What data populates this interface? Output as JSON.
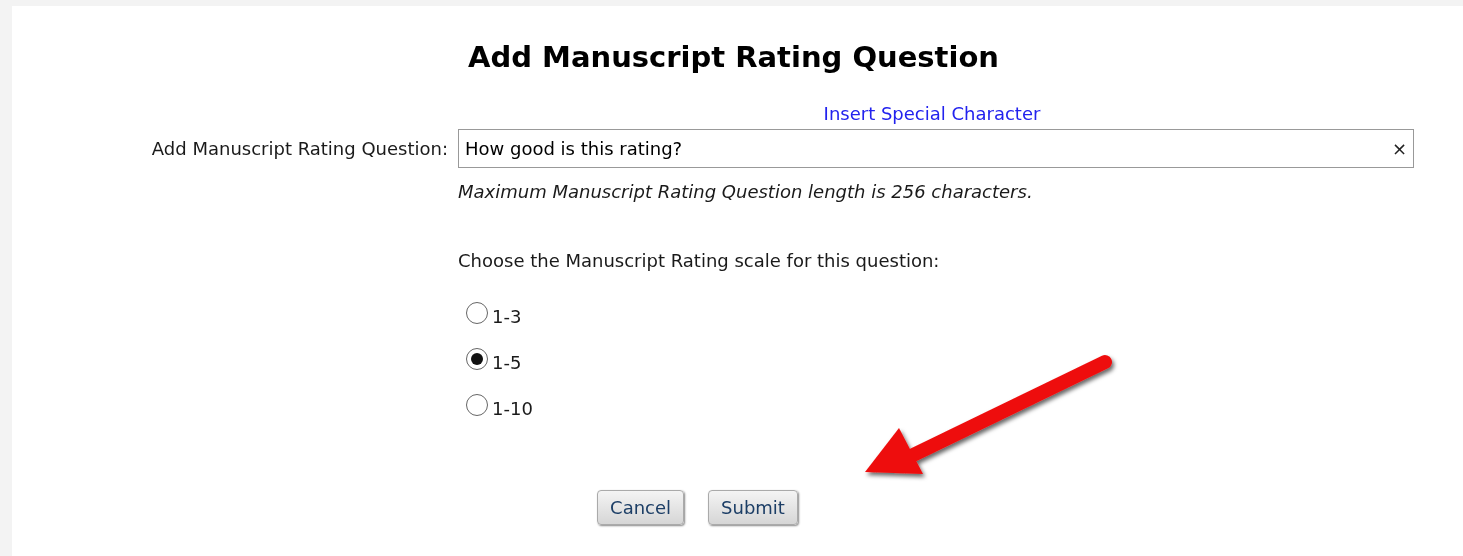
{
  "title": "Add Manuscript Rating Question",
  "special_char_link": "Insert Special Character",
  "question": {
    "label": "Add Manuscript Rating Question:",
    "value": "How good is this rating?",
    "clear": "×",
    "hint": "Maximum Manuscript Rating Question length is 256 characters."
  },
  "scale": {
    "prompt": "Choose the Manuscript Rating scale for this question:",
    "options": [
      {
        "label": "1-3",
        "selected": false
      },
      {
        "label": "1-5",
        "selected": true
      },
      {
        "label": "1-10",
        "selected": false
      }
    ]
  },
  "buttons": [
    {
      "label": "Cancel"
    },
    {
      "label": "Submit"
    }
  ]
}
